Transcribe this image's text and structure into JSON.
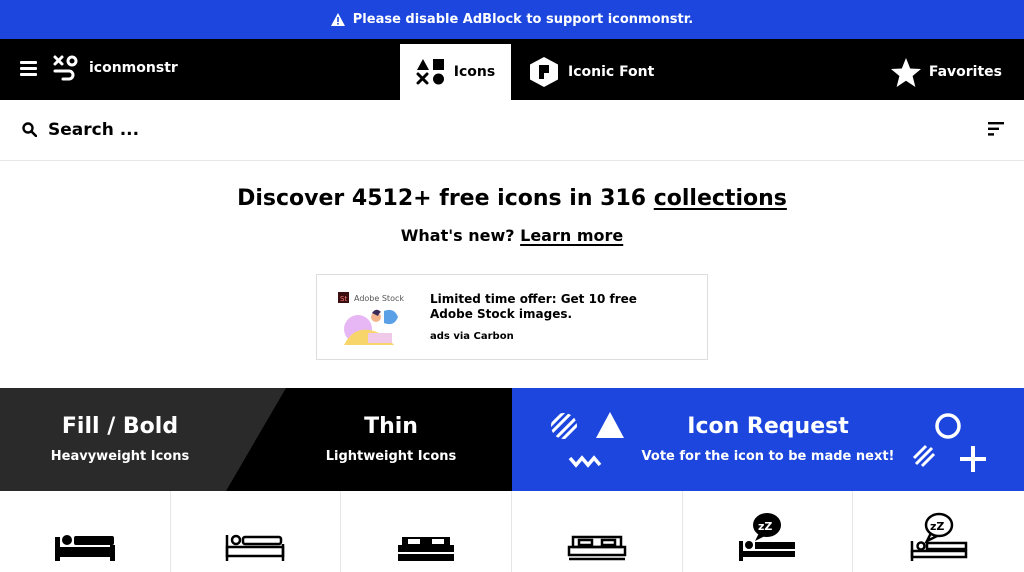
{
  "adbar": {
    "message": "Please disable AdBlock to support iconmonstr.",
    "icon": "warning-icon",
    "color": "#1c46de"
  },
  "nav": {
    "brand": "iconmonstr",
    "tabs": [
      {
        "label": "Icons",
        "icon": "shapes-icon",
        "active": true
      },
      {
        "label": "Iconic Font",
        "icon": "font-logo-icon",
        "active": false
      }
    ],
    "favorites": "Favorites"
  },
  "search": {
    "placeholder": "Search ..."
  },
  "hero": {
    "headline_prefix": "Discover 4512+ free icons in 316 ",
    "headline_link": "collections",
    "whatsnew_prefix": "What's new? ",
    "whatsnew_link": "Learn more"
  },
  "ad": {
    "brand": "Adobe Stock",
    "text": "Limited time offer: Get 10 free Adobe Stock images.",
    "via": "ads via Carbon"
  },
  "banner": {
    "fill_title": "Fill / Bold",
    "fill_sub": "Heavyweight Icons",
    "thin_title": "Thin",
    "thin_sub": "Lightweight Icons",
    "request_title": "Icon Request",
    "request_sub": "Vote for the icon to be made next!",
    "colors": {
      "dark": "#2a2a2a",
      "black": "#000000",
      "blue": "#1c46de"
    }
  },
  "icons": [
    "bed-person-icon",
    "bed-outline-icon",
    "double-bed-icon",
    "double-bed-outline-icon",
    "sleeping-icon",
    "sleeping-outline-icon"
  ]
}
